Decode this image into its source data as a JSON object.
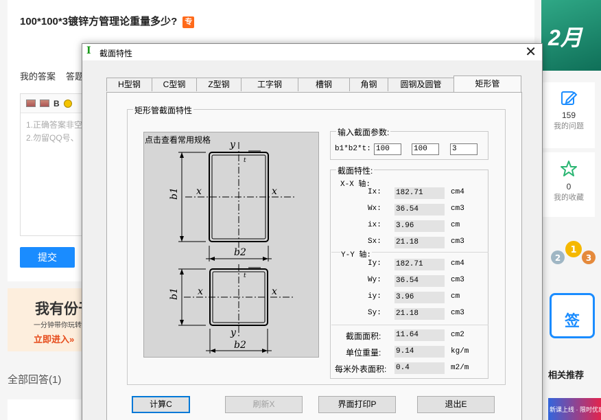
{
  "page": {
    "question_title": "100*100*3镀锌方管理论重量多少?",
    "tag_label": "专",
    "tabs": [
      "我的答案",
      "答题"
    ],
    "editor_hint_lines": [
      "1.正确答案非空",
      "2.勿留QQ号、"
    ],
    "submit_label": "提交",
    "promo": {
      "headline": "我有份于",
      "subline": "一分钟带你玩转",
      "link": "立即进入»"
    },
    "all_answers": "全部回答(1)",
    "sidebar": {
      "banner_text": "2月",
      "my_questions_count": "159",
      "my_questions_label": "我的问题",
      "my_favorites_count": "0",
      "my_favorites_label": "我的收藏",
      "sign_label": "签",
      "related_label": "相关推荐",
      "ad_text": "新课上线 · 限时优惠"
    }
  },
  "dialog": {
    "title": "截面特性",
    "icon_glyph": "I",
    "close_glyph": "✕",
    "tabs": [
      {
        "label": "H型钢"
      },
      {
        "label": "C型钢"
      },
      {
        "label": "Z型钢"
      },
      {
        "label": "工字钢"
      },
      {
        "label": "槽钢"
      },
      {
        "label": "角钢"
      },
      {
        "label": "圆钢及圆管"
      },
      {
        "label": "矩形管",
        "active": true
      }
    ],
    "section_group_title": "矩形管截面特性",
    "drawing_label": "点击查看常用规格",
    "input_group": {
      "title": "输入截面参数:",
      "param_label": "b1*b2*t:",
      "b1": "100",
      "b2": "100",
      "t": "3"
    },
    "props_group": {
      "title": "截面特性:",
      "xx_axis": "X-X 轴:",
      "yy_axis": "Y-Y 轴:",
      "xx": [
        {
          "name": "Ix:",
          "value": "182.71",
          "unit": "cm4"
        },
        {
          "name": "Wx:",
          "value": "36.54",
          "unit": "cm3"
        },
        {
          "name": "ix:",
          "value": "3.96",
          "unit": "cm"
        },
        {
          "name": "Sx:",
          "value": "21.18",
          "unit": "cm3"
        }
      ],
      "yy": [
        {
          "name": "Iy:",
          "value": "182.71",
          "unit": "cm4"
        },
        {
          "name": "Wy:",
          "value": "36.54",
          "unit": "cm3"
        },
        {
          "name": "iy:",
          "value": "3.96",
          "unit": "cm"
        },
        {
          "name": "Sy:",
          "value": "21.18",
          "unit": "cm3"
        }
      ],
      "totals": [
        {
          "name": "截面面积:",
          "value": "11.64",
          "unit": "cm2"
        },
        {
          "name": "单位重量:",
          "value": "9.14",
          "unit": "kg/m"
        },
        {
          "name": "每米外表面积:",
          "value": "0.4",
          "unit": "m2/m"
        }
      ]
    },
    "buttons": {
      "calc": "计算C",
      "refresh": "刷新X",
      "print": "界面打印P",
      "exit": "退出E"
    },
    "diagram_labels": {
      "b1": "b1",
      "b2": "b2",
      "x": "x",
      "y": "y",
      "t": "t"
    }
  }
}
